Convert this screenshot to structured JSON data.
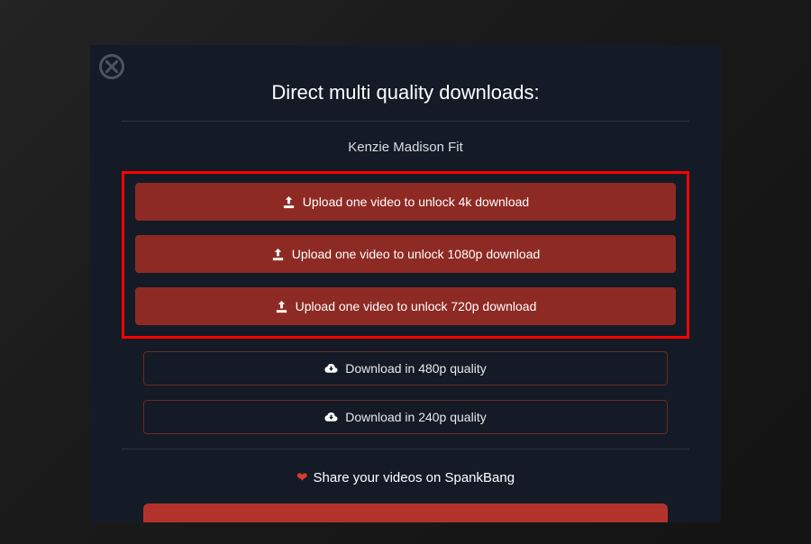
{
  "modal": {
    "title": "Direct multi quality downloads:",
    "video_title": "Kenzie Madison Fit",
    "upload_buttons": [
      {
        "label": "Upload one video to unlock 4k download"
      },
      {
        "label": "Upload one video to unlock 1080p download"
      },
      {
        "label": "Upload one video to unlock 720p download"
      }
    ],
    "download_buttons": [
      {
        "label": "Download in 480p quality"
      },
      {
        "label": "Download in 240p quality"
      }
    ],
    "share_text": "Share your videos on SpankBang"
  }
}
